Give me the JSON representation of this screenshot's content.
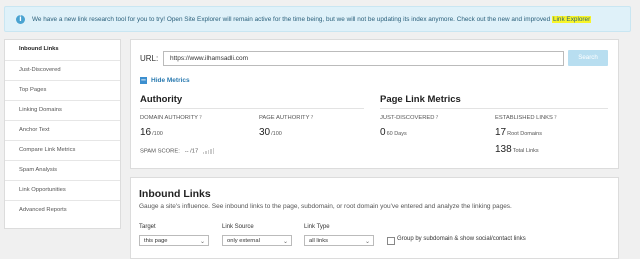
{
  "notice": {
    "text": "We have a new link research tool for you to try! Open Site Explorer will remain active for the time being, but we will not be updating its index anymore. Check out the new and improved",
    "link": "Link Explorer",
    "icon": "info-icon"
  },
  "sidebar": {
    "items": [
      {
        "label": "Inbound Links"
      },
      {
        "label": "Just-Discovered"
      },
      {
        "label": "Top Pages"
      },
      {
        "label": "Linking Domains"
      },
      {
        "label": "Anchor Text"
      },
      {
        "label": "Compare Link Metrics"
      },
      {
        "label": "Spam Analysis"
      },
      {
        "label": "Link Opportunities"
      },
      {
        "label": "Advanced Reports"
      }
    ]
  },
  "search": {
    "url_label": "URL:",
    "url_value": "https://www.ilhamsadli.com",
    "button": "Search"
  },
  "metrics": {
    "toggle": "Hide Metrics",
    "authority": {
      "heading": "Authority",
      "domain_label": "DOMAIN AUTHORITY",
      "domain_value": "16",
      "domain_scale": "/100",
      "page_label": "PAGE AUTHORITY",
      "page_value": "30",
      "page_scale": "/100",
      "spam_label": "SPAM SCORE:",
      "spam_value": "-- /17"
    },
    "page_link": {
      "heading": "Page Link Metrics",
      "just_label": "JUST-DISCOVERED",
      "just_value": "0",
      "just_unit": "60 Days",
      "established_label": "ESTABLISHED LINKS",
      "root_value": "17",
      "root_unit": "Root Domains",
      "total_value": "138",
      "total_unit": "Total Links"
    }
  },
  "inbound": {
    "title": "Inbound Links",
    "description": "Gauge a site's influence. See inbound links to the page, subdomain, or root domain you've entered and analyze the linking pages.",
    "filters": {
      "target_label": "Target",
      "target_value": "this page",
      "source_label": "Link Source",
      "source_value": "only external",
      "type_label": "Link Type",
      "type_value": "all links",
      "group_label": "Group by subdomain & show social/contact links"
    }
  }
}
